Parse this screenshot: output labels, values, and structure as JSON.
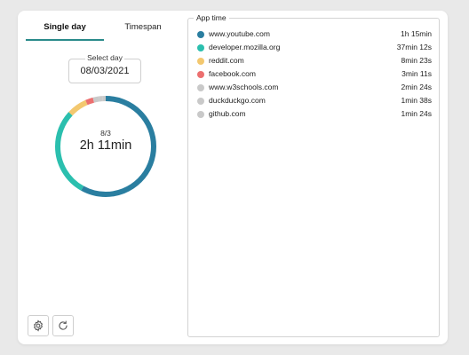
{
  "tabs": {
    "single_day": "Single day",
    "timespan": "Timespan"
  },
  "select_day": {
    "label": "Select day",
    "value": "08/03/2021"
  },
  "summary": {
    "date": "8/3",
    "total": "2h 11min"
  },
  "app_time": {
    "title": "App time",
    "apps": [
      {
        "name": "www.youtube.com",
        "time": "1h 15min",
        "color": "#2a7ea0"
      },
      {
        "name": "developer.mozilla.org",
        "time": "37min 12s",
        "color": "#2bbfae"
      },
      {
        "name": "reddit.com",
        "time": "8min 23s",
        "color": "#f3c86f"
      },
      {
        "name": "facebook.com",
        "time": "3min 11s",
        "color": "#ec6f6f"
      },
      {
        "name": "www.w3schools.com",
        "time": "2min 24s",
        "color": "#c9c9c9"
      },
      {
        "name": "duckduckgo.com",
        "time": "1min 38s",
        "color": "#c9c9c9"
      },
      {
        "name": "github.com",
        "time": "1min 24s",
        "color": "#c9c9c9"
      }
    ]
  },
  "icons": {
    "settings": "gear-icon",
    "refresh": "refresh-icon"
  }
}
